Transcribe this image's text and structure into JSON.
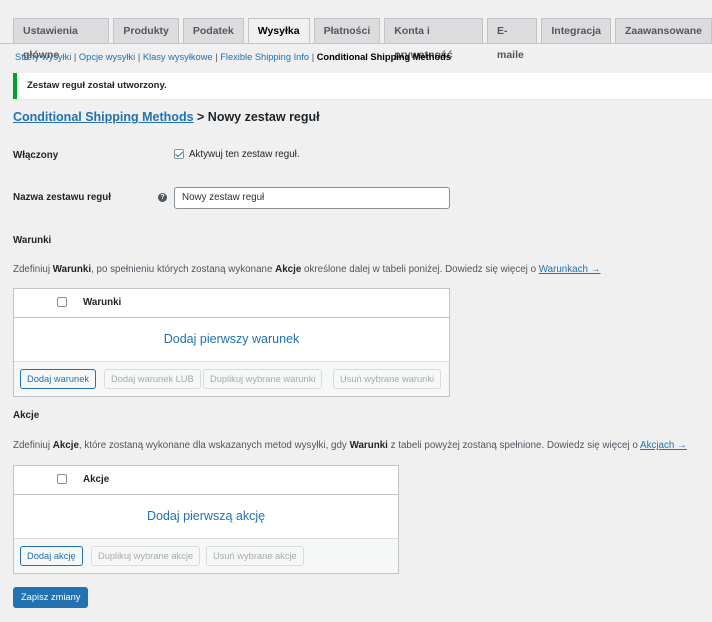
{
  "tabs": [
    "Ustawienia główne",
    "Produkty",
    "Podatek",
    "Wysyłka",
    "Płatności",
    "Konta i prywatność",
    "E-maile",
    "Integracja",
    "Zaawansowane"
  ],
  "active_tab": "Wysyłka",
  "subnav": {
    "items": [
      "Strefy wysyłki",
      "Opcje wysyłki",
      "Klasy wysyłkowe",
      "Flexible Shipping Info"
    ],
    "separator": "|",
    "current": "Conditional Shipping Methods"
  },
  "notice": "Zestaw reguł został utworzony.",
  "title": {
    "link": "Conditional Shipping Methods",
    "rest": "> Nowy zestaw reguł"
  },
  "enabled": {
    "label": "Włączony",
    "checkbox_label": "Aktywuj ten zestaw reguł.",
    "checked": true
  },
  "name_field": {
    "label": "Nazwa zestawu reguł",
    "help_icon": "help-icon",
    "value": "Nowy zestaw reguł"
  },
  "conditions": {
    "heading": "Warunki",
    "desc_pre": "Zdefiniuj",
    "desc_b1": "Warunki",
    "desc_mid": ", po spełnieniu których zostaną wykonane",
    "desc_b2": "Akcje",
    "desc_post": "określone dalej w tabeli poniżej. Dowiedz się więcej o",
    "desc_link": "Warunkach →",
    "table_header": "Warunki",
    "empty_text": "Dodaj pierwszy warunek",
    "buttons": [
      "Dodaj warunek",
      "Dodaj warunek LUB",
      "Duplikuj wybrane warunki",
      "Usuń wybrane warunki"
    ]
  },
  "actions": {
    "heading": "Akcje",
    "desc_pre": "Zdefiniuj",
    "desc_b1": "Akcje",
    "desc_mid": ", które zostaną wykonane dla wskazanych metod wysyłki, gdy",
    "desc_b2": "Warunki",
    "desc_post": "z tabeli powyżej zostaną spełnione. Dowiedz się więcej o",
    "desc_link": "Akcjach →",
    "table_header": "Akcje",
    "empty_text": "Dodaj pierwszą akcję",
    "buttons": [
      "Dodaj akcję",
      "Duplikuj wybrane akcje",
      "Usuń wybrane akcje"
    ]
  },
  "save_label": "Zapisz zmiany",
  "colors": {
    "accent": "#2271b1",
    "success": "#00a32a",
    "background": "#f0f0f1"
  }
}
